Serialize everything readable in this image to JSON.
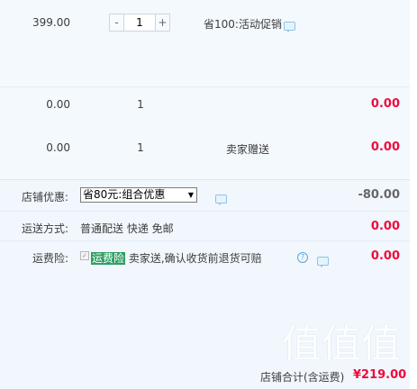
{
  "item_main": {
    "price": "399.00",
    "qty": "1",
    "promo": "省100:活动促销"
  },
  "item_row2": {
    "price": "0.00",
    "qty": "1",
    "total": "0.00"
  },
  "item_row3": {
    "price": "0.00",
    "qty": "1",
    "note": "卖家赠送",
    "total": "0.00"
  },
  "shop_discount": {
    "label": "店铺优惠:",
    "selected": "省80元:组合优惠",
    "amount": "-80.00"
  },
  "shipping": {
    "label": "运送方式:",
    "method": "普通配送 快递 免邮",
    "amount": "0.00"
  },
  "insurance": {
    "label": "运费险:",
    "highlight": "运费险",
    "desc": "卖家送,确认收货前退货可赔",
    "amount": "0.00"
  },
  "summary": {
    "label": "店铺合计(含运费)",
    "amount": "¥219.00"
  },
  "watermark": "值值值",
  "colors": {
    "accent_red": "#ee0a3b",
    "band_blue": "#f1f7fd",
    "highlight_green": "#2f9e63"
  }
}
